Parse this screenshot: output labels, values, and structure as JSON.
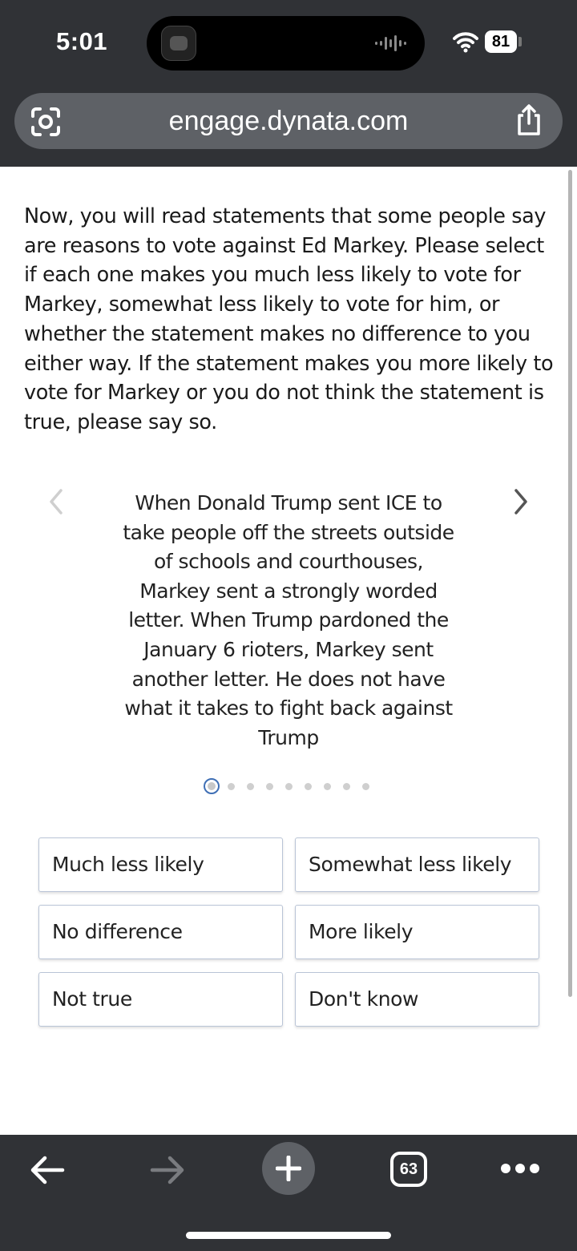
{
  "status_bar": {
    "time": "5:01",
    "battery": "81"
  },
  "browser": {
    "url": "engage.dynata.com",
    "tab_count": "63"
  },
  "survey": {
    "intro": "Now, you will read statements that some people say are reasons to vote against Ed Markey. Please select if each one makes you much less likely to vote for Markey, somewhat less likely to vote for him, or whether the statement makes no difference to you either way. If the statement makes you more likely to vote for Markey or you do not think the statement is true, please say so.",
    "statement": "When Donald Trump sent ICE to take people off the streets outside of schools and courthouses, Markey sent a strongly worded letter. When Trump pardoned the January 6 rioters, Markey sent another letter. He does not have what it takes to fight back against Trump",
    "carousel": {
      "current": 1,
      "total": 9
    },
    "options": [
      "Much less likely",
      "Somewhat less likely",
      "No difference",
      "More likely",
      "Not true",
      "Don't know"
    ]
  },
  "colors": {
    "chrome": "#303236",
    "url_bar": "#5e6166",
    "accent": "#3f6fb5",
    "option_border": "#b9c4d6"
  },
  "icons": [
    "lens-icon",
    "share-icon",
    "chevron-left-icon",
    "chevron-right-icon",
    "back-arrow-icon",
    "forward-arrow-icon",
    "plus-icon",
    "more-icon",
    "wifi-icon"
  ]
}
